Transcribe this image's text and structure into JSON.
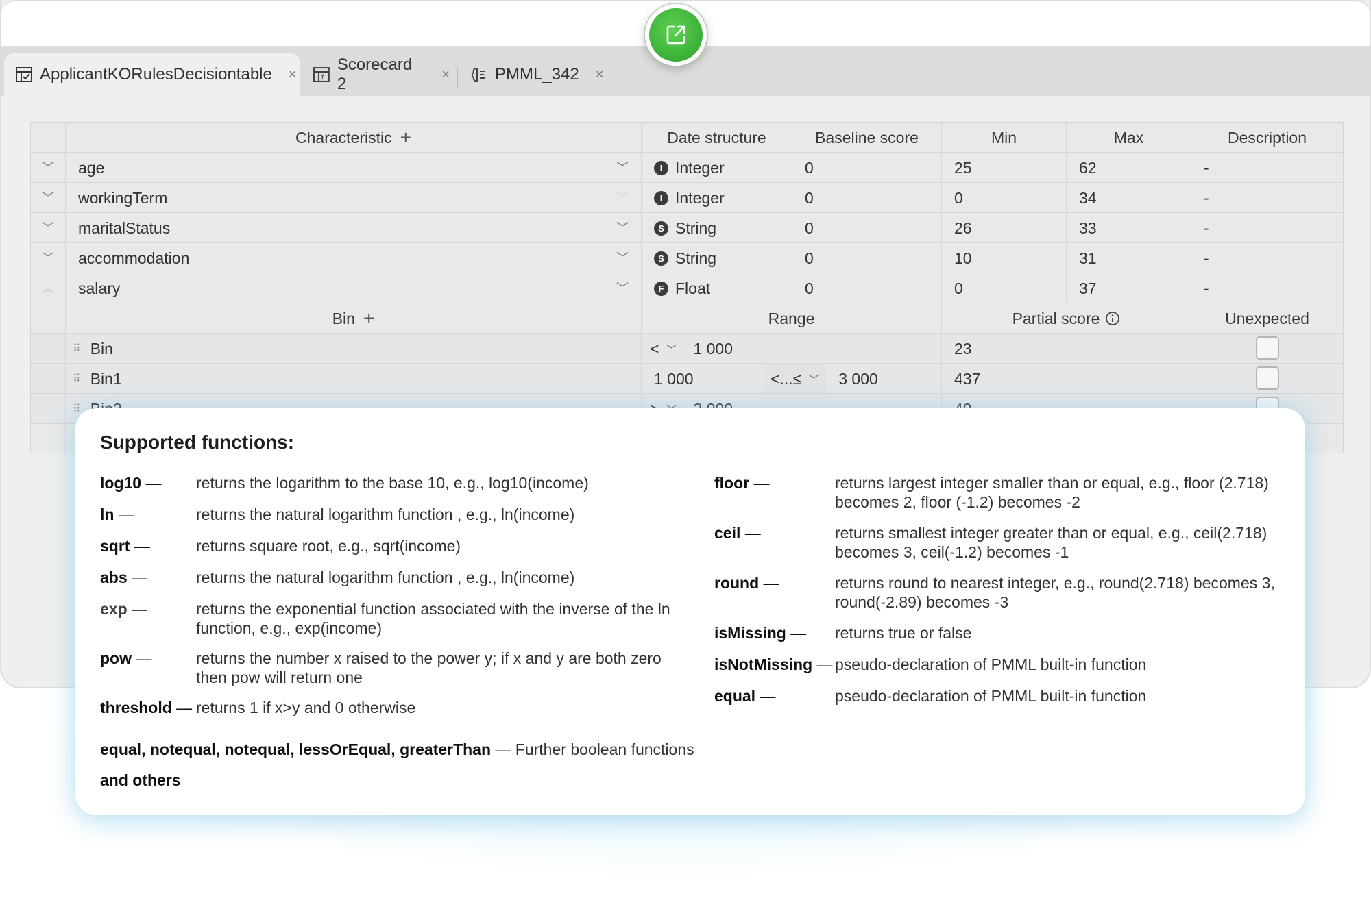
{
  "tabs": [
    {
      "label": "ApplicantKORulesDecisiontable",
      "icon": "decision-table-icon",
      "active": true
    },
    {
      "label": "Scorecard 2",
      "icon": "scorecard-icon",
      "active": false
    },
    {
      "label": "PMML_342",
      "icon": "pmml-icon",
      "active": false
    }
  ],
  "close_glyph": "×",
  "header": {
    "characteristic": "Characteristic",
    "date_structure": "Date structure",
    "baseline_score": "Baseline score",
    "min": "Min",
    "max": "Max",
    "description": "Description"
  },
  "rows": [
    {
      "name": "age",
      "type_letter": "I",
      "type": "Integer",
      "baseline": "0",
      "min": "25",
      "max": "62",
      "description": "-"
    },
    {
      "name": "workingTerm",
      "type_letter": "I",
      "type": "Integer",
      "baseline": "0",
      "min": "0",
      "max": "34",
      "description": "-"
    },
    {
      "name": "maritalStatus",
      "type_letter": "S",
      "type": "String",
      "baseline": "0",
      "min": "26",
      "max": "33",
      "description": "-"
    },
    {
      "name": "accommodation",
      "type_letter": "S",
      "type": "String",
      "baseline": "0",
      "min": "10",
      "max": "31",
      "description": "-"
    },
    {
      "name": "salary",
      "type_letter": "F",
      "type": "Float",
      "baseline": "0",
      "min": "0",
      "max": "37",
      "description": "-"
    }
  ],
  "bin_header": {
    "bin": "Bin",
    "range": "Range",
    "partial_score": "Partial score",
    "unexpected": "Unexpected"
  },
  "bins": [
    {
      "name": "Bin",
      "op": "<",
      "from": "",
      "to": "1 000",
      "score": "23"
    },
    {
      "name": "Bin1",
      "op": "<...≤",
      "from": "1 000",
      "to": "3 000",
      "score": "437"
    },
    {
      "name": "Bin2",
      "op": ">",
      "from": "",
      "to": "3 000",
      "score": "40"
    }
  ],
  "popup": {
    "title": "Supported functions:",
    "left": [
      {
        "name": "log10",
        "desc": "returns the logarithm to the base 10, e.g., log10(income)"
      },
      {
        "name": "ln",
        "desc": "returns the natural logarithm function , e.g., ln(income)"
      },
      {
        "name": "sqrt",
        "desc": "returns square root, e.g., sqrt(income)"
      },
      {
        "name": "abs",
        "desc": "returns the natural logarithm function , e.g.,  ln(income)"
      },
      {
        "name": "exp",
        "desc": "returns the exponential function associated with the inverse of the ln function, e.g., exp(income)"
      },
      {
        "name": "pow",
        "desc": "returns the number x raised to the power y; if x and y are both zero then pow will return one"
      },
      {
        "name": "threshold",
        "desc": "returns 1 if x>y and 0 otherwise"
      }
    ],
    "right": [
      {
        "name": "floor",
        "desc": "returns largest integer smaller than or equal, e.g., floor (2.718) becomes 2, floor (-1.2) becomes -2"
      },
      {
        "name": "ceil",
        "desc": "returns smallest integer greater than or equal, e.g., ceil(2.718) becomes 3, ceil(-1.2) becomes -1"
      },
      {
        "name": "round",
        "desc": "returns round to nearest integer, e.g., round(2.718) becomes 3, round(-2.89) becomes -3"
      },
      {
        "name": "isMissing",
        "desc": "returns true or false"
      },
      {
        "name": "isNotMissing",
        "desc": "pseudo-declaration of PMML built-in function"
      },
      {
        "name": "equal",
        "desc": "pseudo-declaration of PMML built-in function"
      }
    ],
    "dash": "—",
    "boolean_names": "equal, notequal, notequal, lessOrEqual, greaterThan",
    "boolean_desc": "— Further boolean functions",
    "others": "and others"
  }
}
